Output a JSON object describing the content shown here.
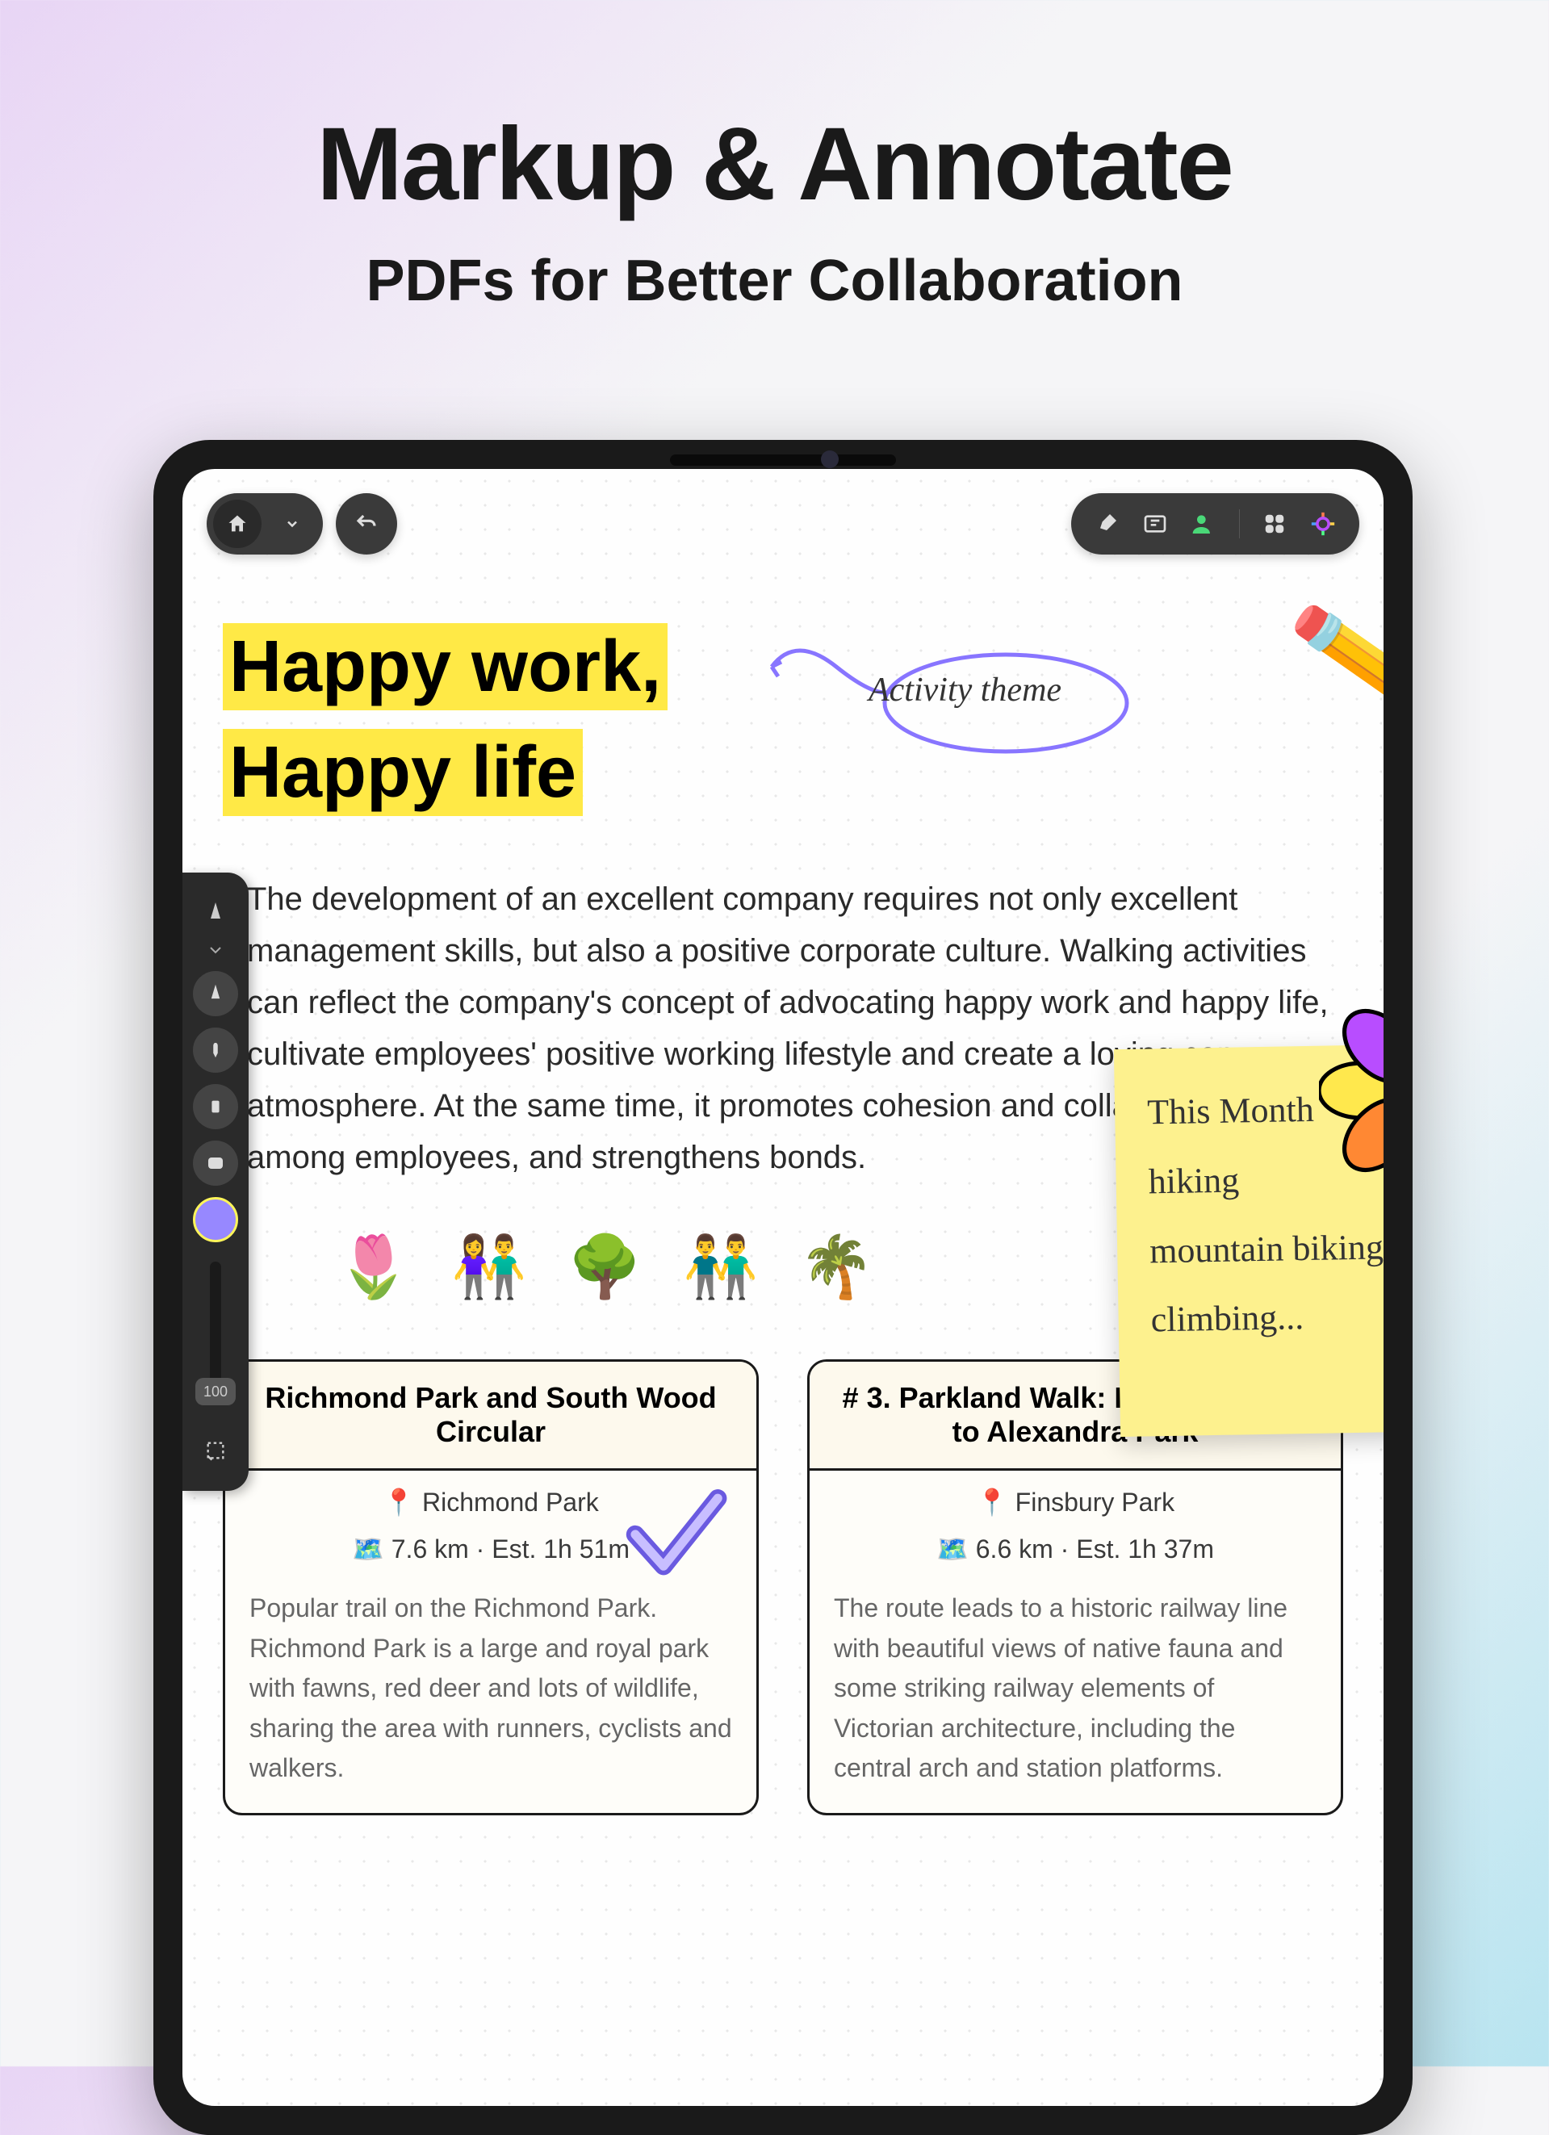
{
  "hero": {
    "title": "Markup & Annotate",
    "subtitle": "PDFs for Better Collaboration"
  },
  "document": {
    "title_line1": "Happy work,",
    "title_line2": "Happy life",
    "body": "The development of an excellent company requires not only excellent management skills, but also a positive corporate culture. Walking activities can reflect the company's concept of advocating happy work and happy life, cultivate employees' positive working lifestyle and create a loving company atmosphere. At the same time, it promotes cohesion and collaboration among employees, and strengthens bonds.",
    "emojis": [
      "🌷",
      "👫",
      "🌳",
      "👬",
      "🌴"
    ]
  },
  "annotation": {
    "label": "Activity theme"
  },
  "sticky": {
    "line1": "This Month",
    "line2": "hiking",
    "line3": "mountain biking",
    "line4": "climbing..."
  },
  "cards": [
    {
      "title": "Richmond Park and South Wood Circular",
      "location": "Richmond Park",
      "stats": "7.6 km · Est. 1h 51m",
      "body": "Popular trail on the Richmond Park. Richmond Park is a large and royal park with fawns, red deer and lots of wildlife, sharing the area with runners, cyclists and walkers."
    },
    {
      "title": "# 3. Parkland Walk: Finsbury Park to Alexandra Park",
      "location": "Finsbury Park",
      "stats": "6.6 km · Est. 1h 37m",
      "body": "The route leads to a historic railway line with beautiful views of native fauna and some striking railway elements of Victorian architecture, including the central arch and station platforms."
    }
  ],
  "slider": {
    "value": "100"
  },
  "icons": {
    "home": "home",
    "chevron": "chevron-down",
    "undo": "undo",
    "highlight": "highlighter",
    "text": "text-box",
    "share": "person-plus",
    "grid": "grid-4",
    "ai": "sparkle"
  }
}
